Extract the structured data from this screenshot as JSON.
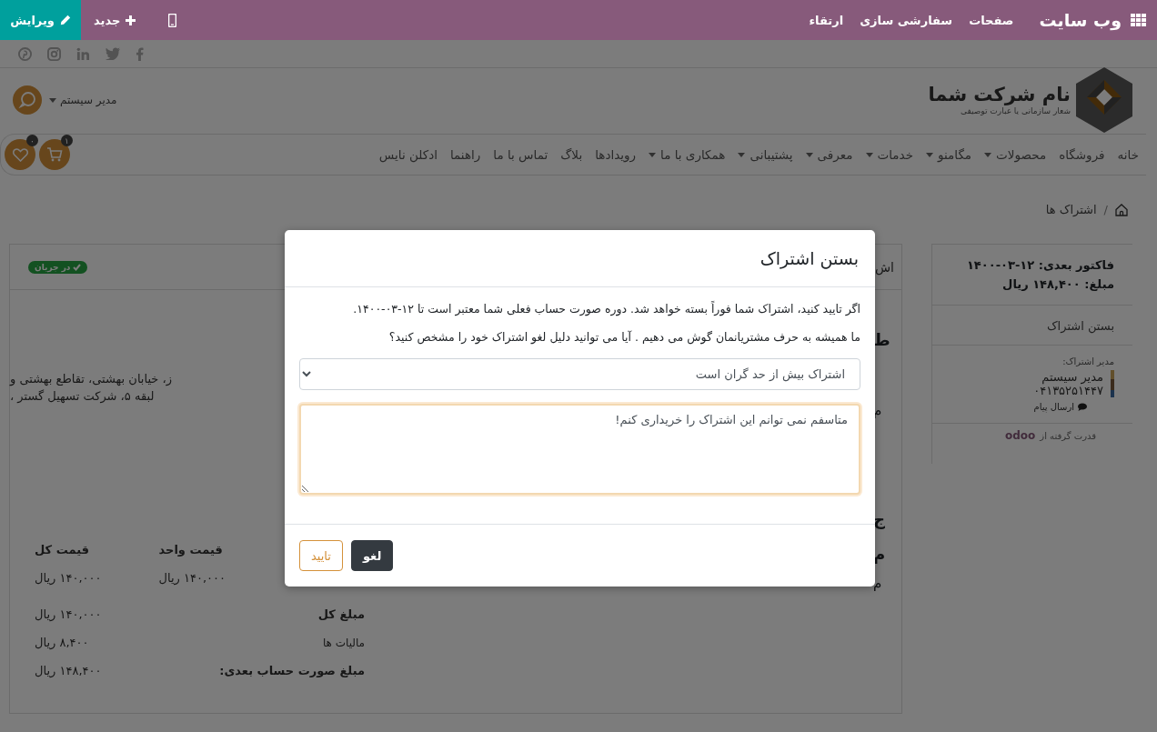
{
  "top_bar": {
    "app_title": "وب سایت",
    "menu": [
      "صفحات",
      "سفارشی سازی",
      "ارتقاء"
    ],
    "new_button": "جدید",
    "edit_button": "ویرایش"
  },
  "header": {
    "company_name": "نام شرکت شما",
    "tagline": "شعار سازمانی یا عبارت توصیفی",
    "user_menu": "مدیر سیستم"
  },
  "nav": {
    "items": [
      {
        "label": "خانه",
        "dropdown": false
      },
      {
        "label": "فروشگاه",
        "dropdown": false
      },
      {
        "label": "محصولات",
        "dropdown": true
      },
      {
        "label": "مگامنو",
        "dropdown": true
      },
      {
        "label": "خدمات",
        "dropdown": true
      },
      {
        "label": "معرفی",
        "dropdown": true
      },
      {
        "label": "پشتیبانی",
        "dropdown": true
      },
      {
        "label": "همکاری با ما",
        "dropdown": true
      },
      {
        "label": "رویدادها",
        "dropdown": false
      },
      {
        "label": "بلاگ",
        "dropdown": false
      },
      {
        "label": "تماس با ما",
        "dropdown": false
      },
      {
        "label": "راهنما",
        "dropdown": false
      },
      {
        "label": "ادکلن نایس",
        "dropdown": false
      }
    ],
    "cart_count": "۱",
    "wishlist_count": "۰"
  },
  "breadcrumb": {
    "separator": "/",
    "items": [
      "اشتراک ها"
    ]
  },
  "sidebar": {
    "next_invoice": "فاکتور بعدی: ۱۲-۰۳-۱۴۰۰",
    "amount": "مبلغ: ۱۴۸,۴۰۰ ریال",
    "close_link": "بستن اشتراک",
    "manager_label": "مدیر اشتراک:",
    "manager_name": "مدیر سیستم",
    "manager_phone": "۰۴۱۳۵۲۵۱۴۴۷",
    "send_message": "ارسال پیام",
    "powered_by": "قدرت گرفته از",
    "powered_logo": "odoo"
  },
  "card": {
    "tab_fragment": "اش",
    "status_badge": "در جریان",
    "fragments": [
      {
        "text": "ط",
        "bold": true
      },
      {
        "text": "م",
        "bold": false
      },
      {
        "text": "ج",
        "bold": true
      },
      {
        "text": "م",
        "bold": true
      },
      {
        "text": "م",
        "bold": false
      }
    ],
    "address_lines": [
      "ز، خیابان بهشتی، تقاطع بهشتی و",
      "لبقه ۵، شرکت تسهیل گستر ،"
    ],
    "columns": [
      "قیمت واحد",
      "قیمت کل"
    ],
    "row": [
      "۱۴۰,۰۰۰ ریال",
      "۱۴۰,۰۰۰ ریال"
    ],
    "totals": [
      {
        "label": "مبلغ کل",
        "value": "۱۴۰,۰۰۰ ریال",
        "bold": true
      },
      {
        "label": "مالیات ها",
        "value": "۸,۴۰۰ ریال",
        "bold": false
      },
      {
        "label": "مبلغ صورت حساب بعدی:",
        "value": "۱۴۸,۴۰۰ ریال",
        "bold": true
      }
    ]
  },
  "modal": {
    "title": "بستن اشتراک",
    "message": "اگر تایید کنید، اشتراک شما فوراً بسته خواهد شد. دوره صورت حساب فعلی شما معتبر است تا ۱۲-۰۳-۱۴۰۰.",
    "question": "ما همیشه به حرف مشتریانمان گوش می دهیم . آیا می توانید دلیل لغو اشتراک خود را مشخص کنید؟",
    "reason": "اشتراک بیش از حد گران است",
    "comment": "متاسفم نمی توانم این اشتراک را خریداری کنم!",
    "buttons": [
      {
        "label": "لغو",
        "kind": "primary"
      },
      {
        "label": "تایید",
        "kind": "outline"
      }
    ]
  }
}
